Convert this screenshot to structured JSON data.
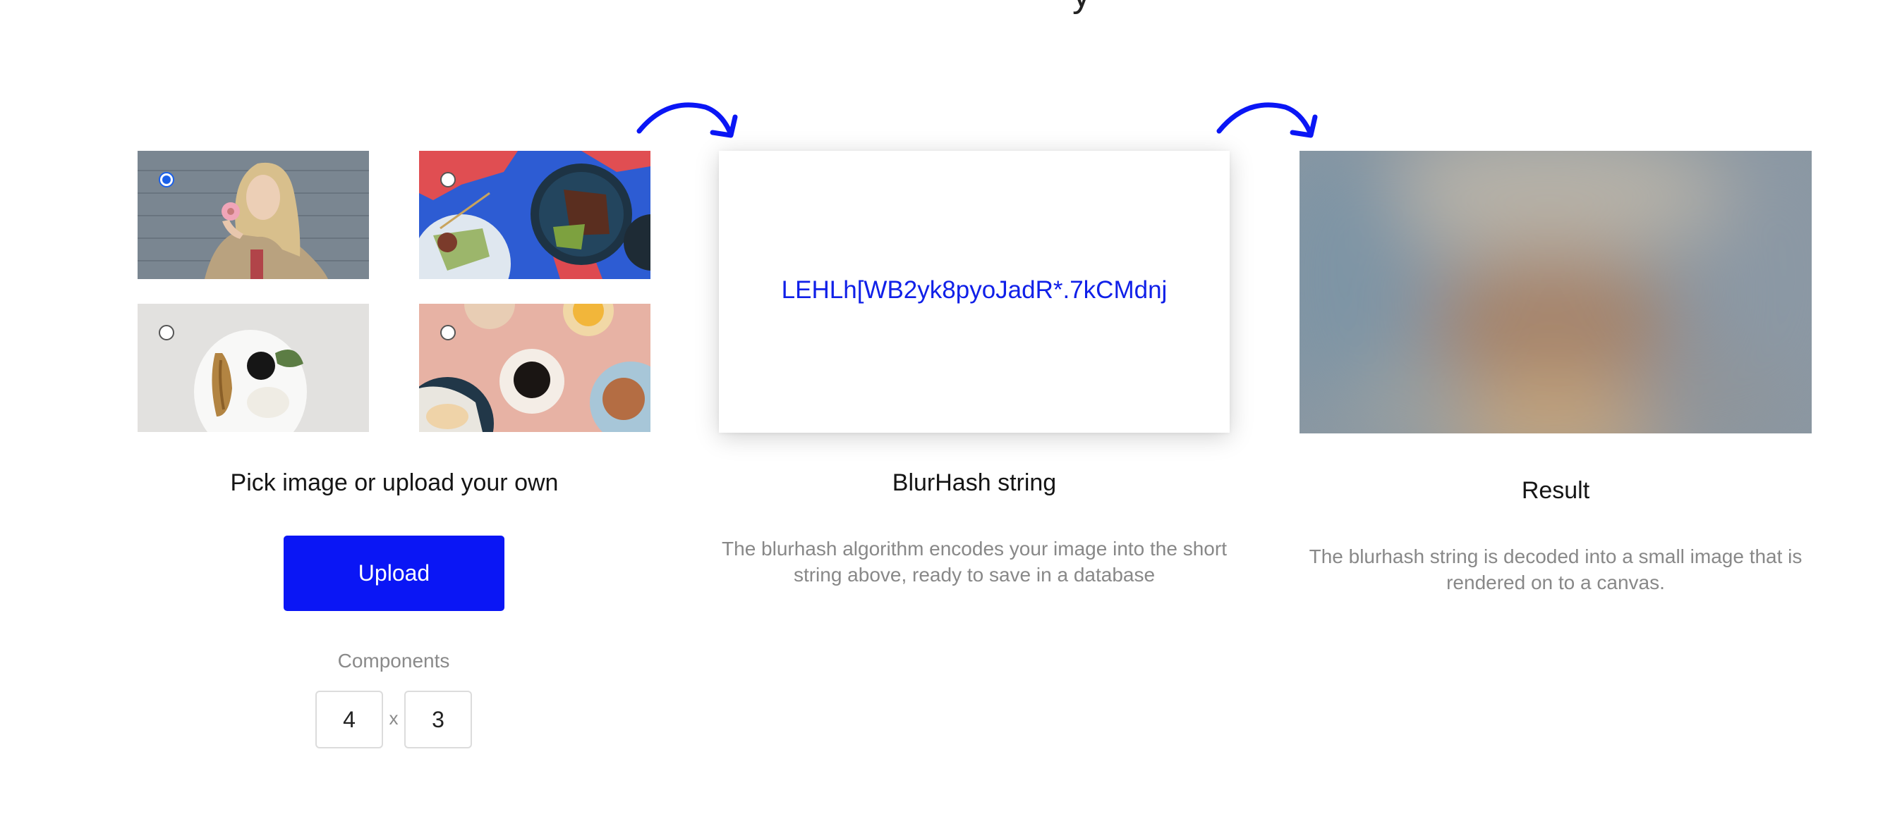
{
  "top_glyph": "y",
  "picker": {
    "heading": "Pick image or upload your own",
    "images": [
      {
        "subject": "woman eating donut",
        "selected": true
      },
      {
        "subject": "plated food on blue background",
        "selected": false
      },
      {
        "subject": "plate with food on gray background",
        "selected": false
      },
      {
        "subject": "coffee and breakfast on pink background",
        "selected": false
      }
    ],
    "upload_label": "Upload",
    "components_label": "Components",
    "components_x": "4",
    "components_sep": "x",
    "components_y": "3"
  },
  "hash": {
    "value": "LEHLh[WB2yk8pyoJadR*.7kCMdnj",
    "heading": "BlurHash string",
    "description": "The blurhash algorithm encodes your image into the short string above, ready to save in a database"
  },
  "result": {
    "heading": "Result",
    "description": "The blurhash string is decoded into a small image that is rendered on to a canvas."
  },
  "colors": {
    "accent_blue": "#0a16f5",
    "hash_text": "#1020e8",
    "radio_selected": "#1a5fe8"
  },
  "icons": [
    "arrow-curve-right-icon",
    "radio-icon"
  ]
}
